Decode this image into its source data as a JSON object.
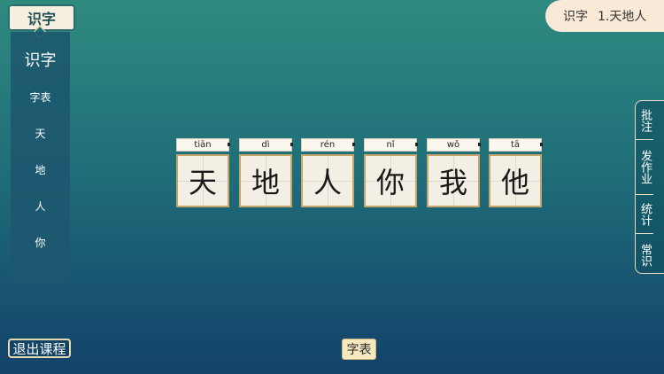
{
  "badge": {
    "label": "识字"
  },
  "left_panel": {
    "title": "识字",
    "items": [
      "字表",
      "天",
      "地",
      "人",
      "你"
    ]
  },
  "breadcrumb": {
    "section": "识字",
    "lesson": "1.天地人"
  },
  "right_menu": {
    "items": [
      "批注",
      "发作业",
      "统计",
      "常识"
    ]
  },
  "cards": [
    {
      "pinyin": "tiān",
      "char": "天"
    },
    {
      "pinyin": "dì",
      "char": "地"
    },
    {
      "pinyin": "rén",
      "char": "人"
    },
    {
      "pinyin": "nǐ",
      "char": "你"
    },
    {
      "pinyin": "wǒ",
      "char": "我"
    },
    {
      "pinyin": "tā",
      "char": "他"
    }
  ],
  "footer": {
    "exit_label": "退出课程",
    "chip_label": "字表"
  }
}
